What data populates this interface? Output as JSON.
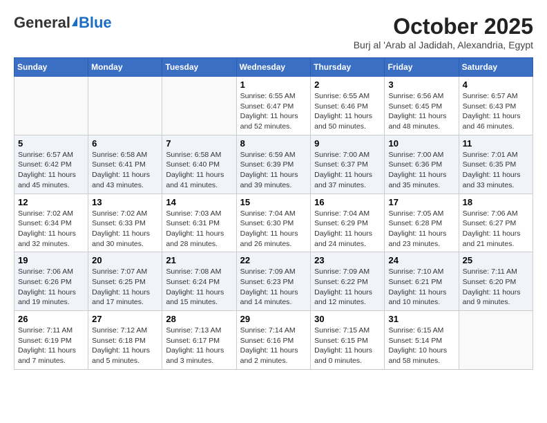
{
  "logo": {
    "general": "General",
    "blue": "Blue"
  },
  "title": "October 2025",
  "location": "Burj al 'Arab al Jadidah, Alexandria, Egypt",
  "days_of_week": [
    "Sunday",
    "Monday",
    "Tuesday",
    "Wednesday",
    "Thursday",
    "Friday",
    "Saturday"
  ],
  "weeks": [
    [
      {
        "day": "",
        "info": ""
      },
      {
        "day": "",
        "info": ""
      },
      {
        "day": "",
        "info": ""
      },
      {
        "day": "1",
        "info": "Sunrise: 6:55 AM\nSunset: 6:47 PM\nDaylight: 11 hours\nand 52 minutes."
      },
      {
        "day": "2",
        "info": "Sunrise: 6:55 AM\nSunset: 6:46 PM\nDaylight: 11 hours\nand 50 minutes."
      },
      {
        "day": "3",
        "info": "Sunrise: 6:56 AM\nSunset: 6:45 PM\nDaylight: 11 hours\nand 48 minutes."
      },
      {
        "day": "4",
        "info": "Sunrise: 6:57 AM\nSunset: 6:43 PM\nDaylight: 11 hours\nand 46 minutes."
      }
    ],
    [
      {
        "day": "5",
        "info": "Sunrise: 6:57 AM\nSunset: 6:42 PM\nDaylight: 11 hours\nand 45 minutes."
      },
      {
        "day": "6",
        "info": "Sunrise: 6:58 AM\nSunset: 6:41 PM\nDaylight: 11 hours\nand 43 minutes."
      },
      {
        "day": "7",
        "info": "Sunrise: 6:58 AM\nSunset: 6:40 PM\nDaylight: 11 hours\nand 41 minutes."
      },
      {
        "day": "8",
        "info": "Sunrise: 6:59 AM\nSunset: 6:39 PM\nDaylight: 11 hours\nand 39 minutes."
      },
      {
        "day": "9",
        "info": "Sunrise: 7:00 AM\nSunset: 6:37 PM\nDaylight: 11 hours\nand 37 minutes."
      },
      {
        "day": "10",
        "info": "Sunrise: 7:00 AM\nSunset: 6:36 PM\nDaylight: 11 hours\nand 35 minutes."
      },
      {
        "day": "11",
        "info": "Sunrise: 7:01 AM\nSunset: 6:35 PM\nDaylight: 11 hours\nand 33 minutes."
      }
    ],
    [
      {
        "day": "12",
        "info": "Sunrise: 7:02 AM\nSunset: 6:34 PM\nDaylight: 11 hours\nand 32 minutes."
      },
      {
        "day": "13",
        "info": "Sunrise: 7:02 AM\nSunset: 6:33 PM\nDaylight: 11 hours\nand 30 minutes."
      },
      {
        "day": "14",
        "info": "Sunrise: 7:03 AM\nSunset: 6:31 PM\nDaylight: 11 hours\nand 28 minutes."
      },
      {
        "day": "15",
        "info": "Sunrise: 7:04 AM\nSunset: 6:30 PM\nDaylight: 11 hours\nand 26 minutes."
      },
      {
        "day": "16",
        "info": "Sunrise: 7:04 AM\nSunset: 6:29 PM\nDaylight: 11 hours\nand 24 minutes."
      },
      {
        "day": "17",
        "info": "Sunrise: 7:05 AM\nSunset: 6:28 PM\nDaylight: 11 hours\nand 23 minutes."
      },
      {
        "day": "18",
        "info": "Sunrise: 7:06 AM\nSunset: 6:27 PM\nDaylight: 11 hours\nand 21 minutes."
      }
    ],
    [
      {
        "day": "19",
        "info": "Sunrise: 7:06 AM\nSunset: 6:26 PM\nDaylight: 11 hours\nand 19 minutes."
      },
      {
        "day": "20",
        "info": "Sunrise: 7:07 AM\nSunset: 6:25 PM\nDaylight: 11 hours\nand 17 minutes."
      },
      {
        "day": "21",
        "info": "Sunrise: 7:08 AM\nSunset: 6:24 PM\nDaylight: 11 hours\nand 15 minutes."
      },
      {
        "day": "22",
        "info": "Sunrise: 7:09 AM\nSunset: 6:23 PM\nDaylight: 11 hours\nand 14 minutes."
      },
      {
        "day": "23",
        "info": "Sunrise: 7:09 AM\nSunset: 6:22 PM\nDaylight: 11 hours\nand 12 minutes."
      },
      {
        "day": "24",
        "info": "Sunrise: 7:10 AM\nSunset: 6:21 PM\nDaylight: 11 hours\nand 10 minutes."
      },
      {
        "day": "25",
        "info": "Sunrise: 7:11 AM\nSunset: 6:20 PM\nDaylight: 11 hours\nand 9 minutes."
      }
    ],
    [
      {
        "day": "26",
        "info": "Sunrise: 7:11 AM\nSunset: 6:19 PM\nDaylight: 11 hours\nand 7 minutes."
      },
      {
        "day": "27",
        "info": "Sunrise: 7:12 AM\nSunset: 6:18 PM\nDaylight: 11 hours\nand 5 minutes."
      },
      {
        "day": "28",
        "info": "Sunrise: 7:13 AM\nSunset: 6:17 PM\nDaylight: 11 hours\nand 3 minutes."
      },
      {
        "day": "29",
        "info": "Sunrise: 7:14 AM\nSunset: 6:16 PM\nDaylight: 11 hours\nand 2 minutes."
      },
      {
        "day": "30",
        "info": "Sunrise: 7:15 AM\nSunset: 6:15 PM\nDaylight: 11 hours\nand 0 minutes."
      },
      {
        "day": "31",
        "info": "Sunrise: 6:15 AM\nSunset: 5:14 PM\nDaylight: 10 hours\nand 58 minutes."
      },
      {
        "day": "",
        "info": ""
      }
    ]
  ]
}
